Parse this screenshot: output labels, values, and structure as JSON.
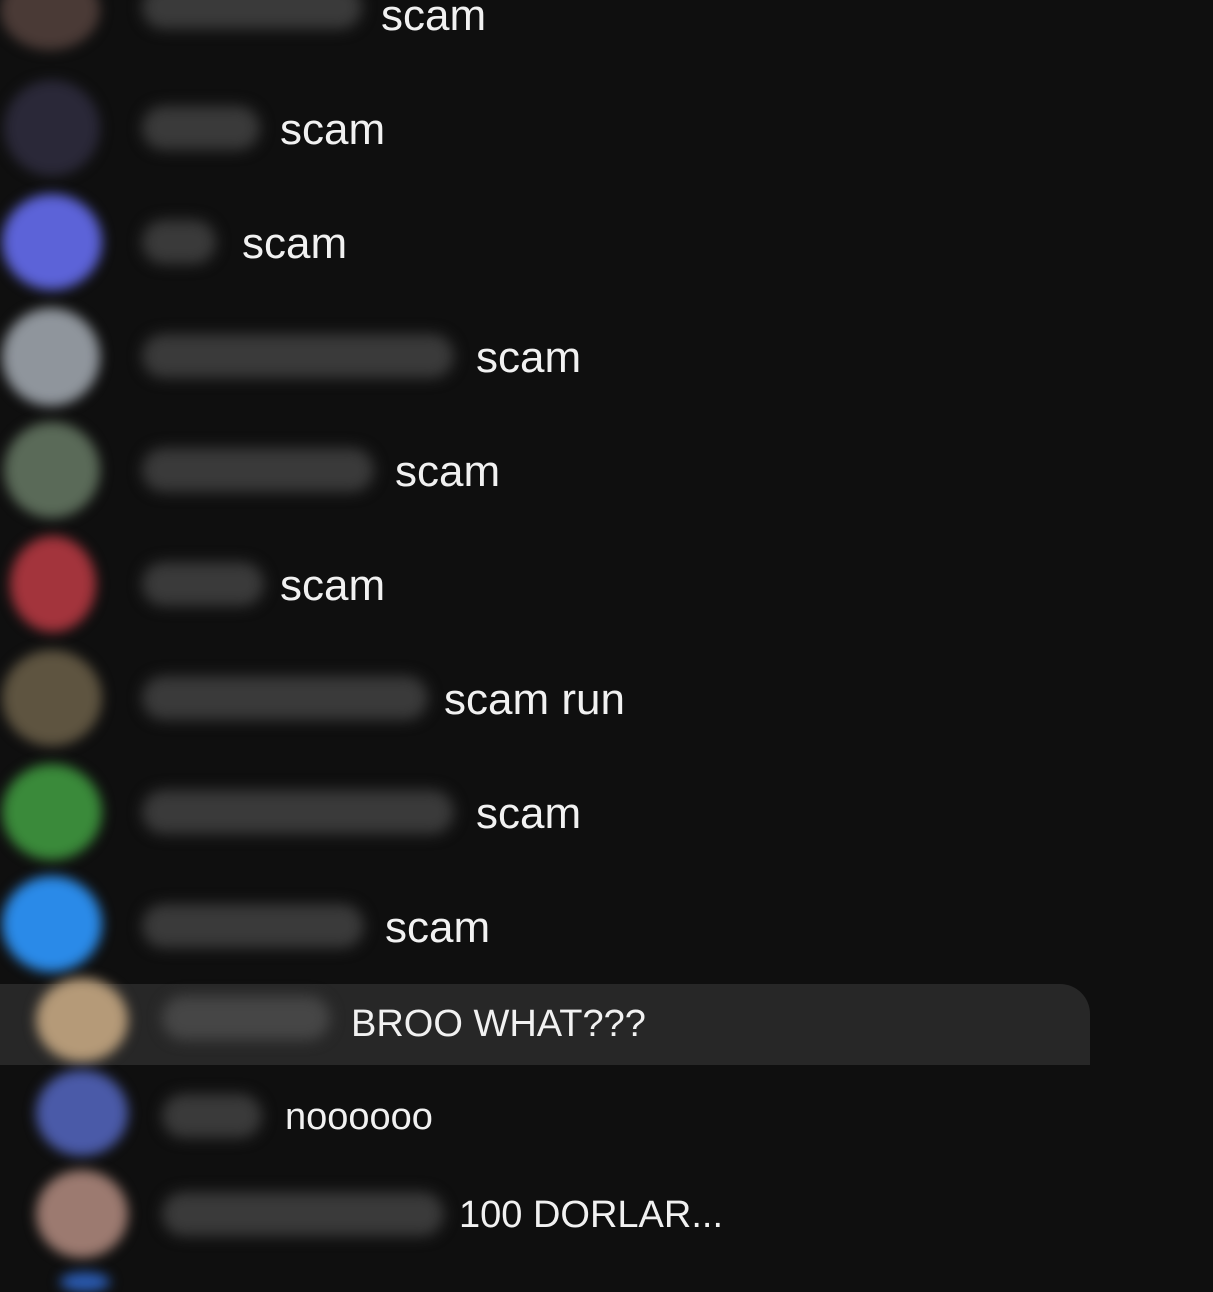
{
  "messages": [
    {
      "text": "scam",
      "avatar_color": "#4a3a36"
    },
    {
      "text": "scam",
      "avatar_color": "#2a2838"
    },
    {
      "text": "scam",
      "avatar_color": "#5c63d8"
    },
    {
      "text": "scam",
      "avatar_color": "#8f959c"
    },
    {
      "text": "scam",
      "avatar_color": "#5a6a58"
    },
    {
      "text": "scam",
      "avatar_color": "#a3343c"
    },
    {
      "text": "scam run",
      "avatar_color": "#5e5440"
    },
    {
      "text": "scam",
      "avatar_color": "#3a8a3a"
    },
    {
      "text": "scam",
      "avatar_color": "#2a8ae8"
    },
    {
      "text": "BROO WHAT???",
      "avatar_color": "#b59a78",
      "highlighted": true
    },
    {
      "text": "noooooo",
      "avatar_color": "#4a5aa8"
    },
    {
      "text": "100 DORLAR...",
      "avatar_color": "#9c7a70"
    }
  ]
}
